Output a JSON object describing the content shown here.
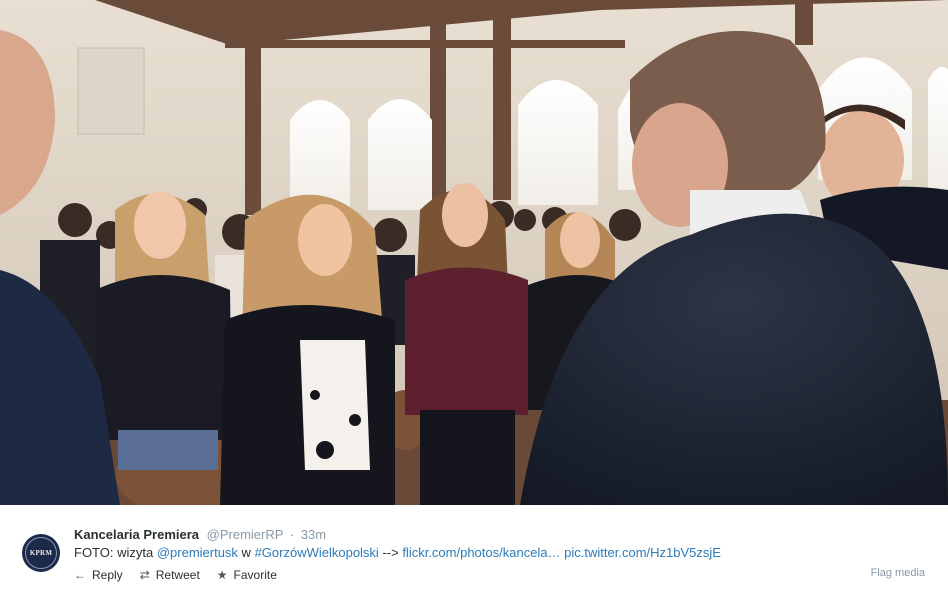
{
  "tweet": {
    "display_name": "Kancelaria Premiera",
    "handle": "@PremierRP",
    "separator": "·",
    "time": "33m",
    "avatar_text": "KPRM",
    "text_prefix": "FOTO: wizyta ",
    "mention": "@premiertusk",
    "text_mid": " w ",
    "hashtag": "#GorzówWielkopolski",
    "arrow": " --> ",
    "link": "flickr.com/photos/kancela…",
    "pic_link": "pic.twitter.com/Hz1bV5zsjE"
  },
  "actions": {
    "reply_label": "Reply",
    "reply_icon": "reply-arrow-icon",
    "retweet_label": "Retweet",
    "retweet_icon": "retweet-icon",
    "favorite_label": "Favorite",
    "favorite_icon": "star-icon"
  },
  "flag_media": "Flag media",
  "colors": {
    "link": "#2b7bb9",
    "muted": "#8899a6",
    "text": "#292f33"
  }
}
